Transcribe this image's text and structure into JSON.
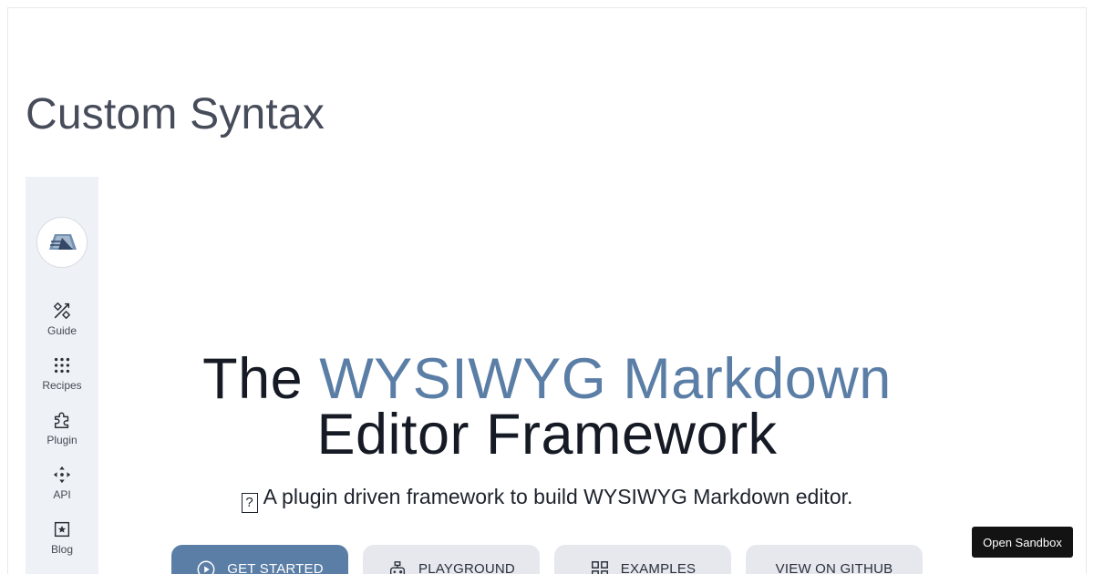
{
  "page": {
    "title": "Custom Syntax"
  },
  "sidebar": {
    "logo": "milkdown-logo",
    "items": [
      {
        "label": "Guide",
        "icon": "tools-icon"
      },
      {
        "label": "Recipes",
        "icon": "grid-dots-icon"
      },
      {
        "label": "Plugin",
        "icon": "puzzle-icon"
      },
      {
        "label": "API",
        "icon": "move-arrows-icon"
      },
      {
        "label": "Blog",
        "icon": "star-box-icon"
      }
    ]
  },
  "hero": {
    "title_prefix": "The",
    "title_accent": "WYSIWYG Markdown",
    "title_line2": "Editor Framework",
    "tagline_icon": "?",
    "tagline": "A plugin driven framework to build WYSIWYG Markdown editor."
  },
  "buttons": {
    "get_started": "GET STARTED",
    "playground": "PLAYGROUND",
    "examples": "EXAMPLES",
    "github": "VIEW ON GITHUB"
  },
  "sandbox": {
    "label": "Open Sandbox"
  },
  "colors": {
    "accent": "#5b7ea6",
    "sidebar_bg": "#eef1f5",
    "secondary_button_bg": "#e6e8ee",
    "sandbox_bg": "#131313"
  }
}
